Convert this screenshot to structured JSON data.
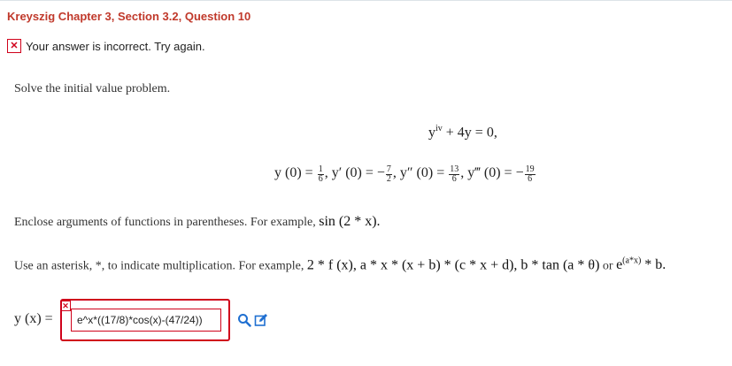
{
  "header": {
    "title": "Kreyszig Chapter 3, Section 3.2, Question 10"
  },
  "status": {
    "icon": "x-mark-icon",
    "message": "Your answer is incorrect.  Try again."
  },
  "problem": {
    "prompt": "Solve the initial value problem.",
    "equation": {
      "lhs_y": "y",
      "order": "iv",
      "rest": " + 4y = 0,"
    },
    "conditions": {
      "c1_lhs": "y (0) = ",
      "c1_num": "1",
      "c1_den": "6",
      "c2_lhs": ", y′ (0) = −",
      "c2_num": "7",
      "c2_den": "2",
      "c3_lhs": ", y″ (0) = ",
      "c3_num": "13",
      "c3_den": "6",
      "c4_lhs": ", y‴ (0) = −",
      "c4_num": "19",
      "c4_den": "6"
    }
  },
  "instructions": {
    "parens_text": "Enclose arguments of functions in parentheses. For example, ",
    "parens_example": "sin (2 * x).",
    "asterisk_text": "Use an asterisk, *, to indicate multiplication. For example, ",
    "asterisk_example": "2 * f (x), a * x * (x + b) * (c * x + d), b * tan (a * θ)",
    "asterisk_or": " or ",
    "asterisk_exp_base": "e",
    "asterisk_exp_power": "(a*x)",
    "asterisk_exp_tail": " * b."
  },
  "answer": {
    "label": "y (x) =",
    "value": "e^x*((17/8)*cos(x)-(47/24))",
    "check_icon": "magnifier-icon",
    "edit_icon": "pencil-square-icon",
    "accent_color": "#d0021b",
    "icon_color": "#1f6fd1"
  }
}
